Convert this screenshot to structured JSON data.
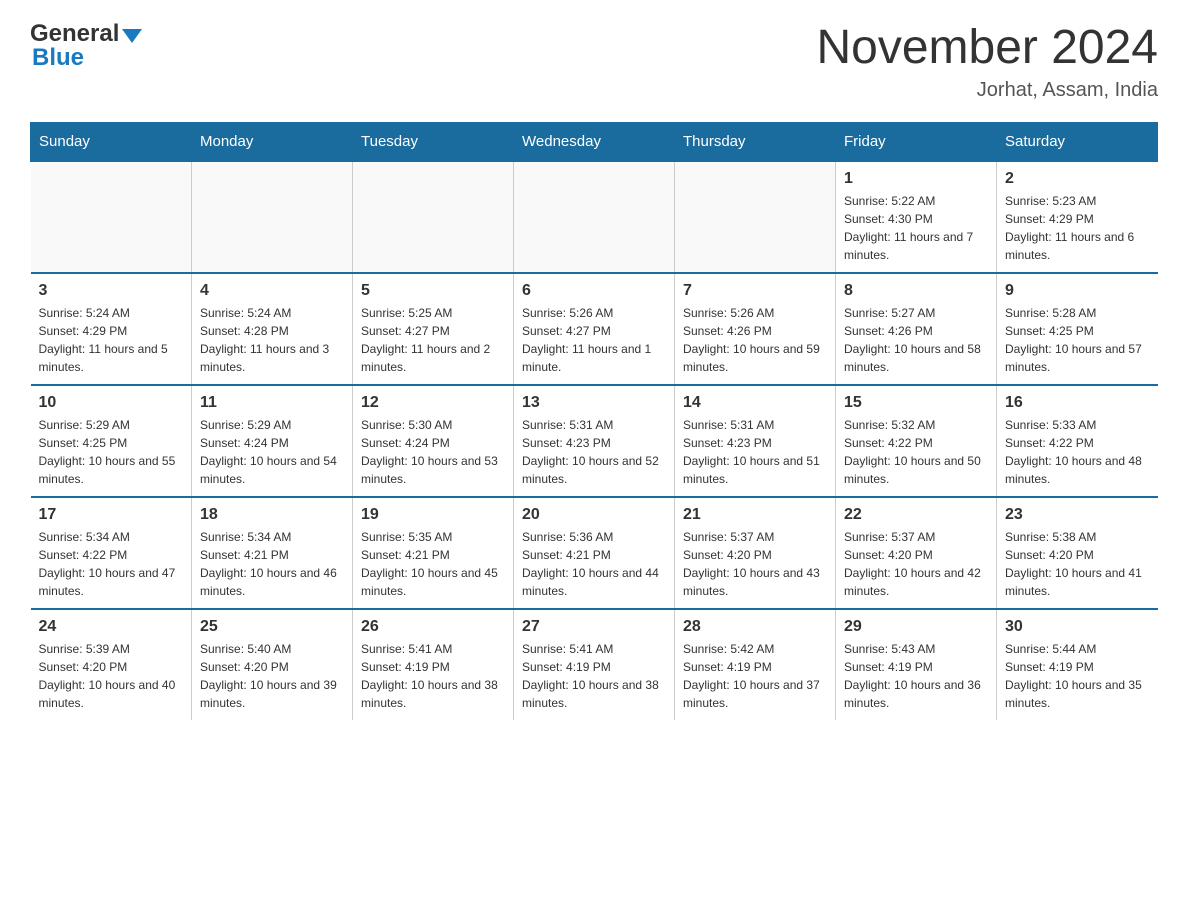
{
  "header": {
    "logo": {
      "general": "General",
      "blue": "Blue",
      "aria": "GeneralBlue logo"
    },
    "title": "November 2024",
    "subtitle": "Jorhat, Assam, India"
  },
  "days_header": [
    "Sunday",
    "Monday",
    "Tuesday",
    "Wednesday",
    "Thursday",
    "Friday",
    "Saturday"
  ],
  "weeks": [
    {
      "days": [
        {
          "num": "",
          "info": ""
        },
        {
          "num": "",
          "info": ""
        },
        {
          "num": "",
          "info": ""
        },
        {
          "num": "",
          "info": ""
        },
        {
          "num": "",
          "info": ""
        },
        {
          "num": "1",
          "info": "Sunrise: 5:22 AM\nSunset: 4:30 PM\nDaylight: 11 hours and 7 minutes."
        },
        {
          "num": "2",
          "info": "Sunrise: 5:23 AM\nSunset: 4:29 PM\nDaylight: 11 hours and 6 minutes."
        }
      ]
    },
    {
      "days": [
        {
          "num": "3",
          "info": "Sunrise: 5:24 AM\nSunset: 4:29 PM\nDaylight: 11 hours and 5 minutes."
        },
        {
          "num": "4",
          "info": "Sunrise: 5:24 AM\nSunset: 4:28 PM\nDaylight: 11 hours and 3 minutes."
        },
        {
          "num": "5",
          "info": "Sunrise: 5:25 AM\nSunset: 4:27 PM\nDaylight: 11 hours and 2 minutes."
        },
        {
          "num": "6",
          "info": "Sunrise: 5:26 AM\nSunset: 4:27 PM\nDaylight: 11 hours and 1 minute."
        },
        {
          "num": "7",
          "info": "Sunrise: 5:26 AM\nSunset: 4:26 PM\nDaylight: 10 hours and 59 minutes."
        },
        {
          "num": "8",
          "info": "Sunrise: 5:27 AM\nSunset: 4:26 PM\nDaylight: 10 hours and 58 minutes."
        },
        {
          "num": "9",
          "info": "Sunrise: 5:28 AM\nSunset: 4:25 PM\nDaylight: 10 hours and 57 minutes."
        }
      ]
    },
    {
      "days": [
        {
          "num": "10",
          "info": "Sunrise: 5:29 AM\nSunset: 4:25 PM\nDaylight: 10 hours and 55 minutes."
        },
        {
          "num": "11",
          "info": "Sunrise: 5:29 AM\nSunset: 4:24 PM\nDaylight: 10 hours and 54 minutes."
        },
        {
          "num": "12",
          "info": "Sunrise: 5:30 AM\nSunset: 4:24 PM\nDaylight: 10 hours and 53 minutes."
        },
        {
          "num": "13",
          "info": "Sunrise: 5:31 AM\nSunset: 4:23 PM\nDaylight: 10 hours and 52 minutes."
        },
        {
          "num": "14",
          "info": "Sunrise: 5:31 AM\nSunset: 4:23 PM\nDaylight: 10 hours and 51 minutes."
        },
        {
          "num": "15",
          "info": "Sunrise: 5:32 AM\nSunset: 4:22 PM\nDaylight: 10 hours and 50 minutes."
        },
        {
          "num": "16",
          "info": "Sunrise: 5:33 AM\nSunset: 4:22 PM\nDaylight: 10 hours and 48 minutes."
        }
      ]
    },
    {
      "days": [
        {
          "num": "17",
          "info": "Sunrise: 5:34 AM\nSunset: 4:22 PM\nDaylight: 10 hours and 47 minutes."
        },
        {
          "num": "18",
          "info": "Sunrise: 5:34 AM\nSunset: 4:21 PM\nDaylight: 10 hours and 46 minutes."
        },
        {
          "num": "19",
          "info": "Sunrise: 5:35 AM\nSunset: 4:21 PM\nDaylight: 10 hours and 45 minutes."
        },
        {
          "num": "20",
          "info": "Sunrise: 5:36 AM\nSunset: 4:21 PM\nDaylight: 10 hours and 44 minutes."
        },
        {
          "num": "21",
          "info": "Sunrise: 5:37 AM\nSunset: 4:20 PM\nDaylight: 10 hours and 43 minutes."
        },
        {
          "num": "22",
          "info": "Sunrise: 5:37 AM\nSunset: 4:20 PM\nDaylight: 10 hours and 42 minutes."
        },
        {
          "num": "23",
          "info": "Sunrise: 5:38 AM\nSunset: 4:20 PM\nDaylight: 10 hours and 41 minutes."
        }
      ]
    },
    {
      "days": [
        {
          "num": "24",
          "info": "Sunrise: 5:39 AM\nSunset: 4:20 PM\nDaylight: 10 hours and 40 minutes."
        },
        {
          "num": "25",
          "info": "Sunrise: 5:40 AM\nSunset: 4:20 PM\nDaylight: 10 hours and 39 minutes."
        },
        {
          "num": "26",
          "info": "Sunrise: 5:41 AM\nSunset: 4:19 PM\nDaylight: 10 hours and 38 minutes."
        },
        {
          "num": "27",
          "info": "Sunrise: 5:41 AM\nSunset: 4:19 PM\nDaylight: 10 hours and 38 minutes."
        },
        {
          "num": "28",
          "info": "Sunrise: 5:42 AM\nSunset: 4:19 PM\nDaylight: 10 hours and 37 minutes."
        },
        {
          "num": "29",
          "info": "Sunrise: 5:43 AM\nSunset: 4:19 PM\nDaylight: 10 hours and 36 minutes."
        },
        {
          "num": "30",
          "info": "Sunrise: 5:44 AM\nSunset: 4:19 PM\nDaylight: 10 hours and 35 minutes."
        }
      ]
    }
  ]
}
